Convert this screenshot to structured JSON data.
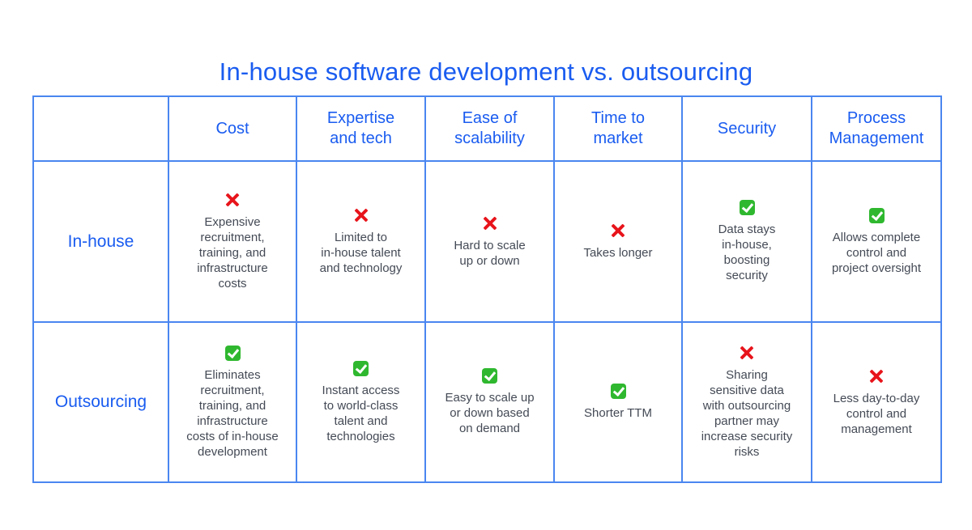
{
  "title": "In-house software development vs. outsourcing",
  "colors": {
    "accent": "#1a5cf0",
    "border": "#4a86f0",
    "negative": "#e8141b",
    "positive": "#2fb82f",
    "text": "#444a55"
  },
  "columns": [
    "Cost",
    "Expertise\nand tech",
    "Ease of\nscalability",
    "Time to\nmarket",
    "Security",
    "Process\nManagement"
  ],
  "column_lines": [
    [
      "Cost"
    ],
    [
      "Expertise",
      "and tech"
    ],
    [
      "Ease of",
      "scalability"
    ],
    [
      "Time to",
      "market"
    ],
    [
      "Security"
    ],
    [
      "Process",
      "Management"
    ]
  ],
  "rows": [
    {
      "label": "In-house",
      "cells": [
        {
          "icon": "cross-icon",
          "lines": [
            "Expensive",
            "recruitment,",
            "training, and",
            "infrastructure",
            "costs"
          ]
        },
        {
          "icon": "cross-icon",
          "lines": [
            "Limited to",
            "in-house talent",
            "and technology"
          ]
        },
        {
          "icon": "cross-icon",
          "lines": [
            "Hard to scale",
            "up or down"
          ]
        },
        {
          "icon": "cross-icon",
          "lines": [
            "Takes longer"
          ]
        },
        {
          "icon": "check-icon",
          "lines": [
            "Data stays",
            "in-house,",
            "boosting",
            "security"
          ]
        },
        {
          "icon": "check-icon",
          "lines": [
            "Allows complete",
            "control and",
            "project oversight"
          ]
        }
      ]
    },
    {
      "label": "Outsourcing",
      "cells": [
        {
          "icon": "check-icon",
          "lines": [
            "Eliminates",
            "recruitment,",
            "training, and",
            "infrastructure",
            "costs of in-house",
            "development"
          ]
        },
        {
          "icon": "check-icon",
          "lines": [
            "Instant access",
            "to world-class",
            "talent and",
            "technologies"
          ]
        },
        {
          "icon": "check-icon",
          "lines": [
            "Easy to scale up",
            "or down based",
            "on demand"
          ]
        },
        {
          "icon": "check-icon",
          "lines": [
            "Shorter TTM"
          ]
        },
        {
          "icon": "cross-icon",
          "lines": [
            "Sharing",
            "sensitive data",
            "with outsourcing",
            "partner may",
            "increase security",
            "risks"
          ]
        },
        {
          "icon": "cross-icon",
          "lines": [
            "Less day-to-day",
            "control and",
            "management"
          ]
        }
      ]
    }
  ]
}
